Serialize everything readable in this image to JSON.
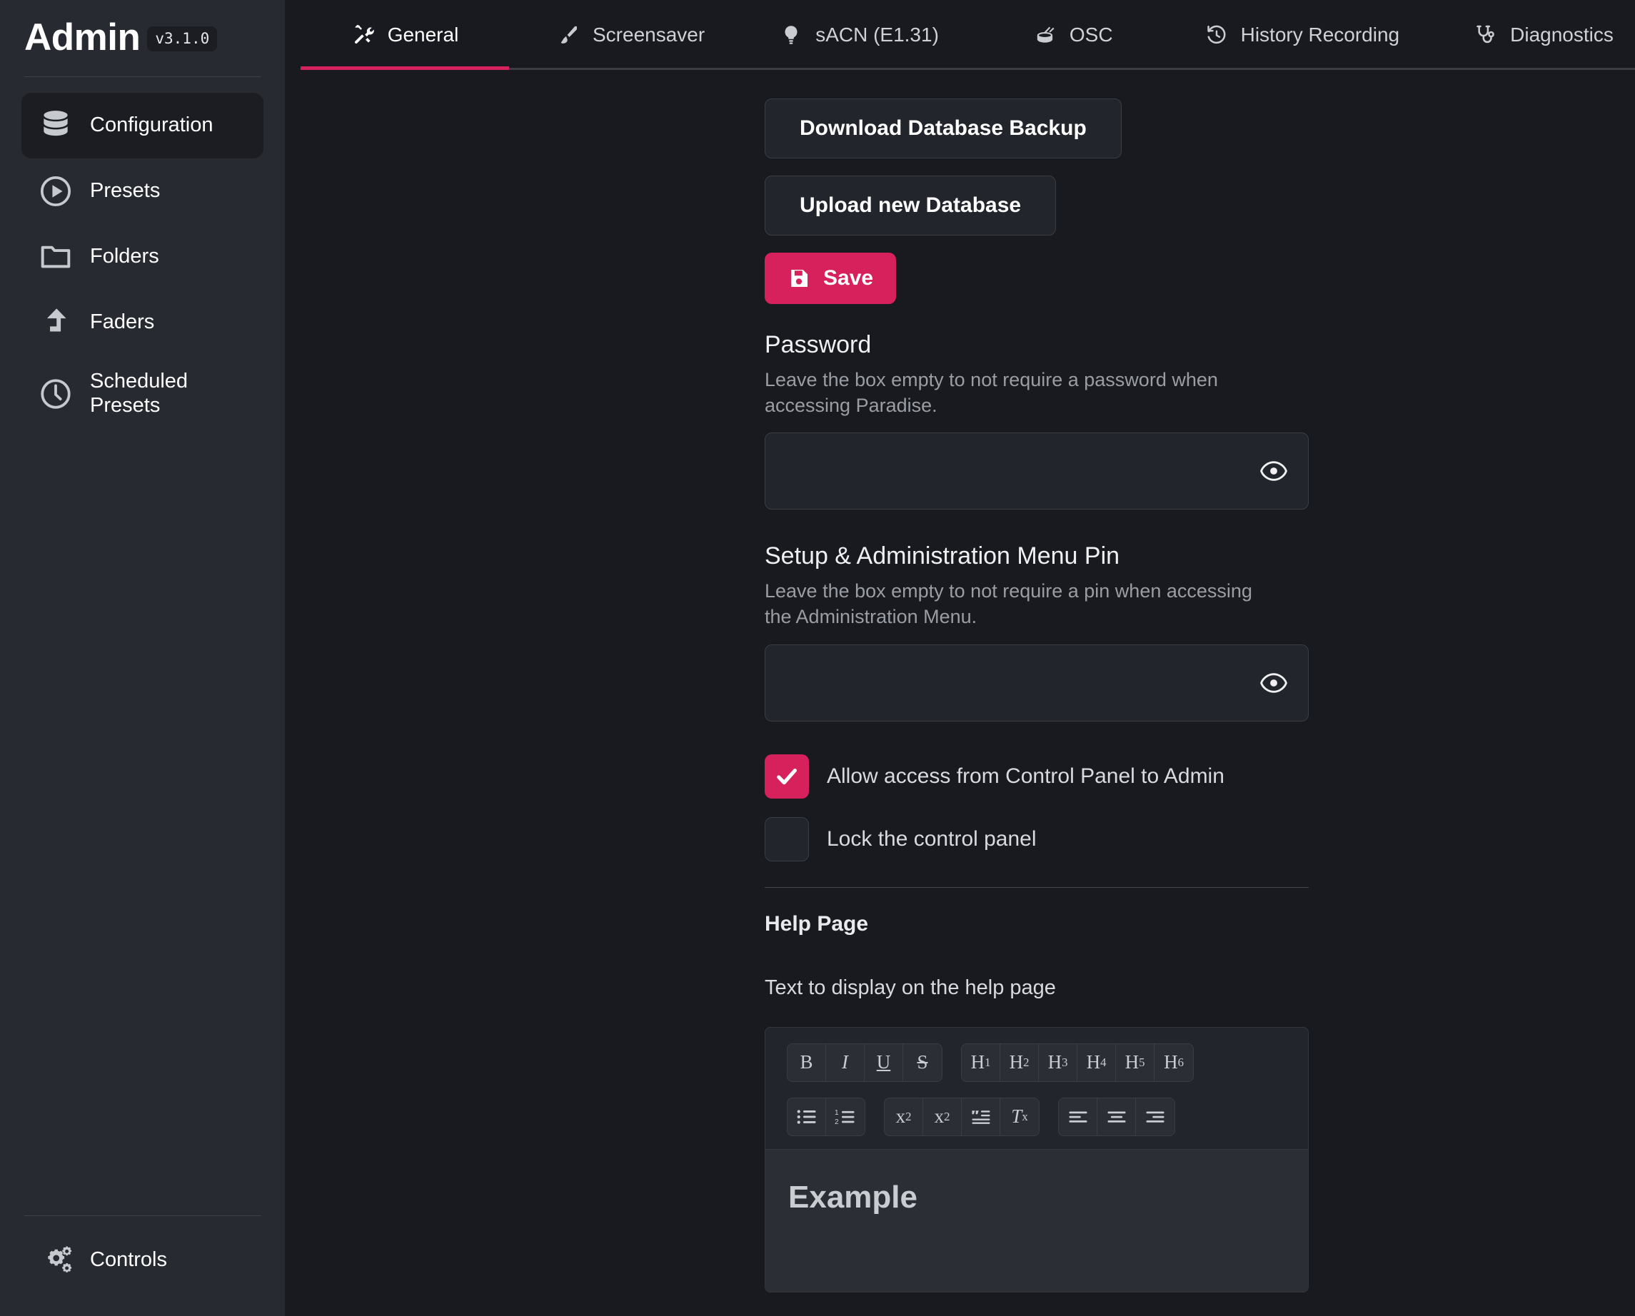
{
  "brand": {
    "title": "Admin",
    "version": "v3.1.0"
  },
  "sidebar": {
    "items": [
      {
        "label": "Configuration",
        "icon": "database-icon",
        "active": true
      },
      {
        "label": "Presets",
        "icon": "play-circle-icon",
        "active": false
      },
      {
        "label": "Folders",
        "icon": "folder-icon",
        "active": false
      },
      {
        "label": "Faders",
        "icon": "level-up-arrow-icon",
        "active": false
      },
      {
        "label": "Scheduled Presets",
        "icon": "clock-icon",
        "active": false
      }
    ],
    "bottom": {
      "label": "Controls",
      "icon": "gears-icon"
    }
  },
  "tabs": [
    {
      "label": "General",
      "icon": "tools-icon",
      "active": true
    },
    {
      "label": "Screensaver",
      "icon": "paintbrush-icon",
      "active": false
    },
    {
      "label": "sACN (E1.31)",
      "icon": "lightbulb-icon",
      "active": false
    },
    {
      "label": "OSC",
      "icon": "drum-icon",
      "active": false
    },
    {
      "label": "History Recording",
      "icon": "history-icon",
      "active": false
    },
    {
      "label": "Diagnostics",
      "icon": "stethoscope-icon",
      "active": false
    }
  ],
  "main": {
    "download_backup_label": "Download Database Backup",
    "upload_database_label": "Upload new Database",
    "save_label": "Save",
    "password": {
      "title": "Password",
      "help": "Leave the box empty to not require a password when accessing Paradise.",
      "value": "",
      "placeholder": ""
    },
    "pin": {
      "title": "Setup & Administration Menu Pin",
      "help": "Leave the box empty to not require a pin when accessing the Administration Menu.",
      "value": "",
      "placeholder": ""
    },
    "checkboxes": [
      {
        "label": "Allow access from Control Panel to Admin",
        "checked": true
      },
      {
        "label": "Lock the control panel",
        "checked": false
      }
    ],
    "help_page": {
      "heading": "Help Page",
      "description": "Text to display on the help page",
      "toolbar": {
        "row1_group1": [
          "B",
          "I",
          "U",
          "S"
        ],
        "row1_group2": [
          "H1",
          "H2",
          "H3",
          "H4",
          "H5",
          "H6"
        ],
        "row2_group1": [
          "bullet-list-icon",
          "ordered-list-icon"
        ],
        "row2_group2": [
          "superscript-icon",
          "subscript-icon",
          "blockquote-icon",
          "clear-format-icon"
        ],
        "row2_group3": [
          "align-left-icon",
          "align-center-icon",
          "align-right-icon"
        ]
      },
      "body_text": "Example"
    }
  },
  "colors": {
    "accent": "#d6215c",
    "sidebar_bg": "#272a31",
    "main_bg": "#181a1f",
    "panel_bg": "#22252b"
  }
}
